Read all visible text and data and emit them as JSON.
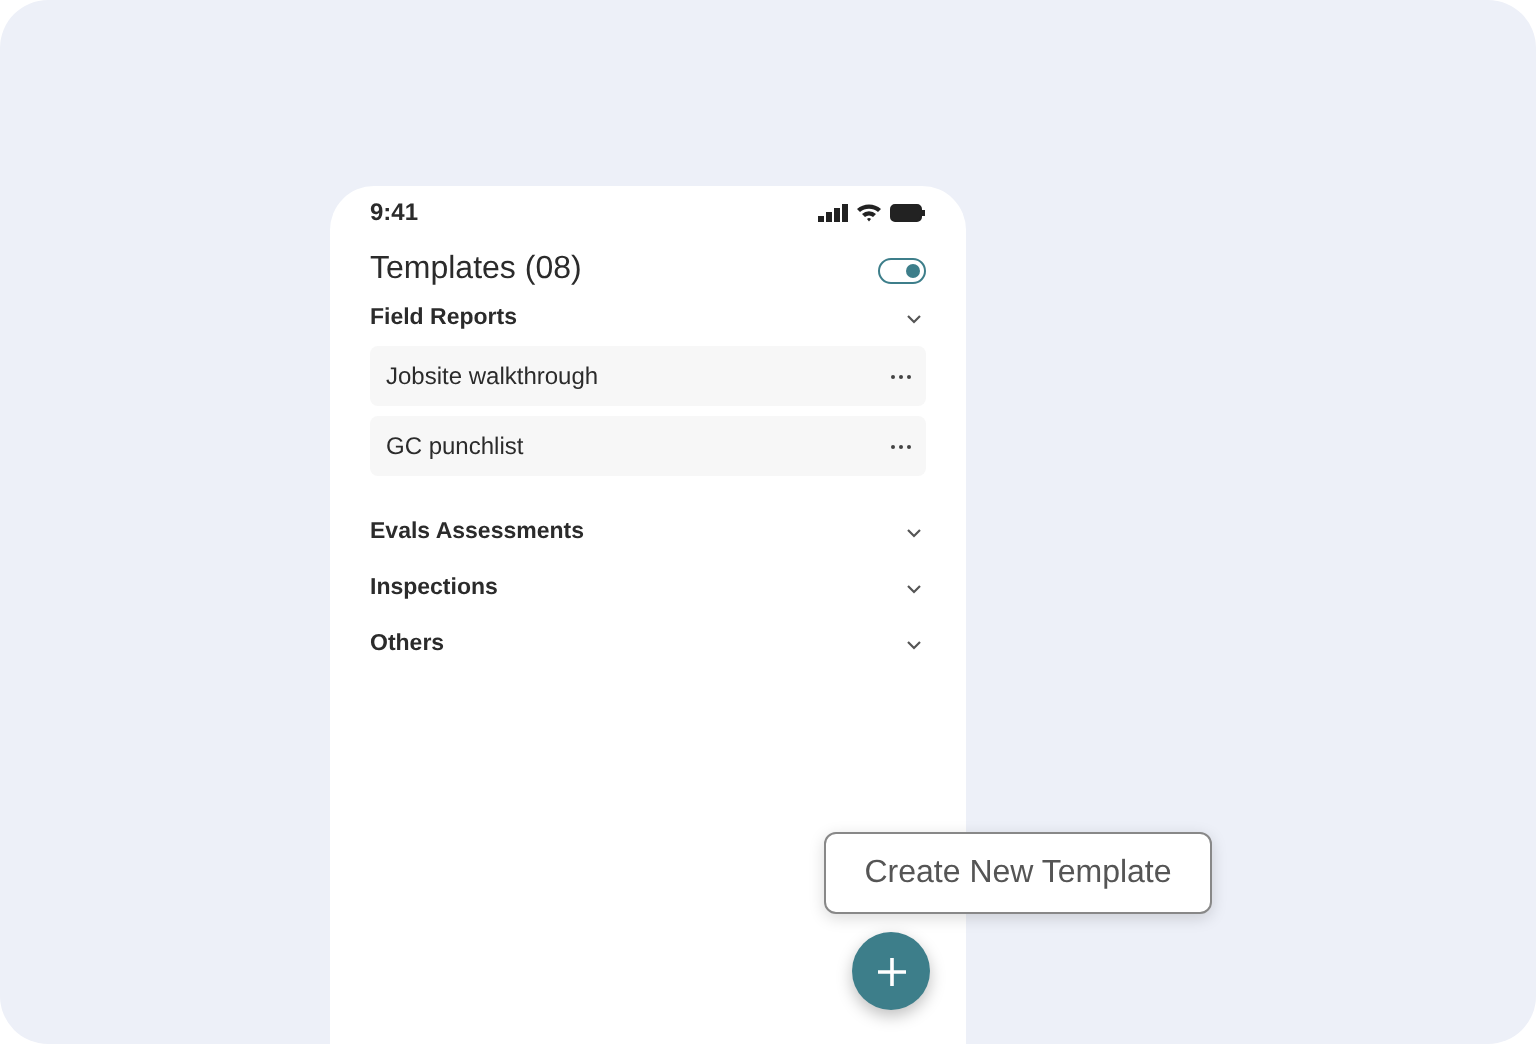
{
  "status_bar": {
    "time": "9:41"
  },
  "header": {
    "title": "Templates (08)",
    "toggle": {
      "on": true
    }
  },
  "sections": [
    {
      "title": "Field Reports",
      "items": [
        {
          "label": "Jobsite walkthrough"
        },
        {
          "label": "GC punchlist"
        }
      ]
    },
    {
      "title": "Evals Assessments"
    },
    {
      "title": "Inspections"
    },
    {
      "title": "Others"
    }
  ],
  "tooltip": "Create New Template"
}
